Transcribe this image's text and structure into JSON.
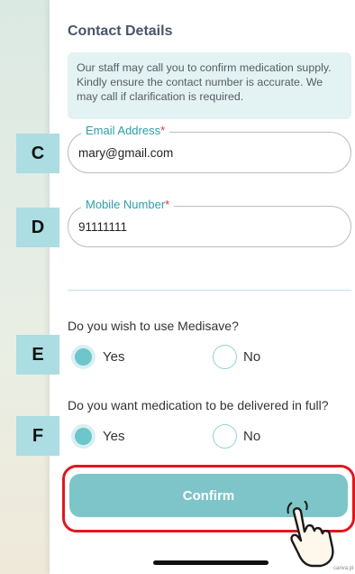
{
  "contact": {
    "title": "Contact Details",
    "info_line1": "Our staff may call you to confirm medication supply.",
    "info_line2": "Kindly ensure the contact number is accurate. We",
    "info_line3": "may call if clarification is required."
  },
  "email": {
    "label": "Email Address",
    "required_mark": "*",
    "value": "mary@gmail.com",
    "badge": "C"
  },
  "mobile": {
    "label": "Mobile Number",
    "required_mark": "*",
    "value": "91111111",
    "badge": "D"
  },
  "medisave": {
    "question": "Do you wish to use Medisave?",
    "badge": "E",
    "options": [
      {
        "label": "Yes",
        "selected": true
      },
      {
        "label": "No",
        "selected": false
      }
    ]
  },
  "delivery": {
    "question": "Do you want medication to be delivered in full?",
    "badge": "F",
    "options": [
      {
        "label": "Yes",
        "selected": true
      },
      {
        "label": "No",
        "selected": false
      }
    ]
  },
  "confirm_label": "Confirm",
  "credit": "canva.pi",
  "colors": {
    "accent": "#6cc6cb",
    "button": "#7ec5c9",
    "highlight_outline": "#e0171f",
    "required": "#e0303a",
    "label_text": "#2d9ea8",
    "badge_bg": "#abdde2"
  },
  "icons": {
    "pointer": "pointing-hand-icon"
  }
}
